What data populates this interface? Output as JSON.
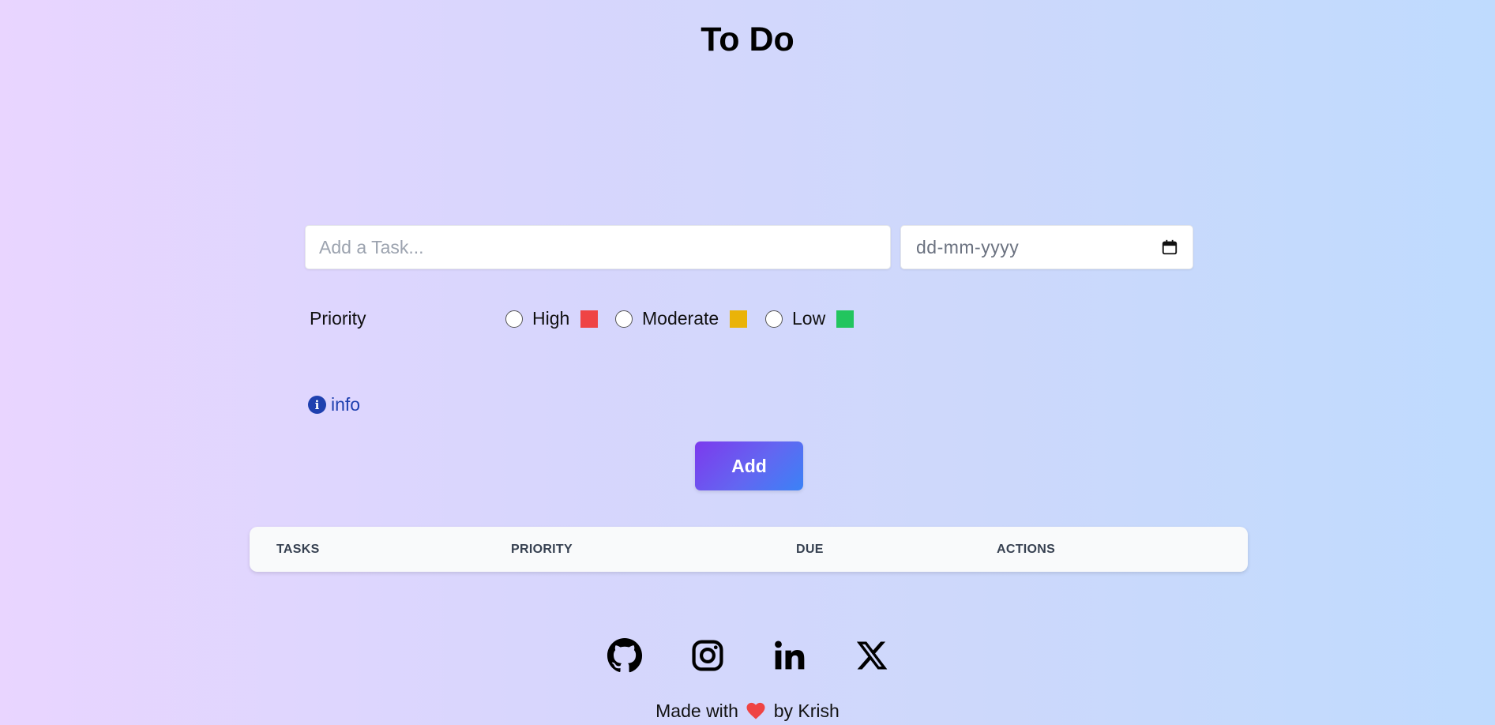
{
  "header": {
    "title": "To Do"
  },
  "form": {
    "task_placeholder": "Add a Task...",
    "task_value": "",
    "date_placeholder": "dd-mm-yyyy",
    "priority_label": "Priority",
    "priorities": [
      {
        "label": "High",
        "color": "#ef4444",
        "selected": false
      },
      {
        "label": "Moderate",
        "color": "#eab308",
        "selected": false
      },
      {
        "label": "Low",
        "color": "#22c55e",
        "selected": false
      }
    ],
    "info_label": "info",
    "add_label": "Add"
  },
  "table": {
    "columns": [
      "TASKS",
      "PRIORITY",
      "DUE",
      "ACTIONS"
    ],
    "rows": []
  },
  "socials": [
    {
      "name": "github-icon"
    },
    {
      "name": "instagram-icon"
    },
    {
      "name": "linkedin-icon"
    },
    {
      "name": "x-icon"
    }
  ],
  "footer": {
    "made_with": "Made with",
    "by": "by Krish",
    "heart_color": "#ef4444"
  }
}
